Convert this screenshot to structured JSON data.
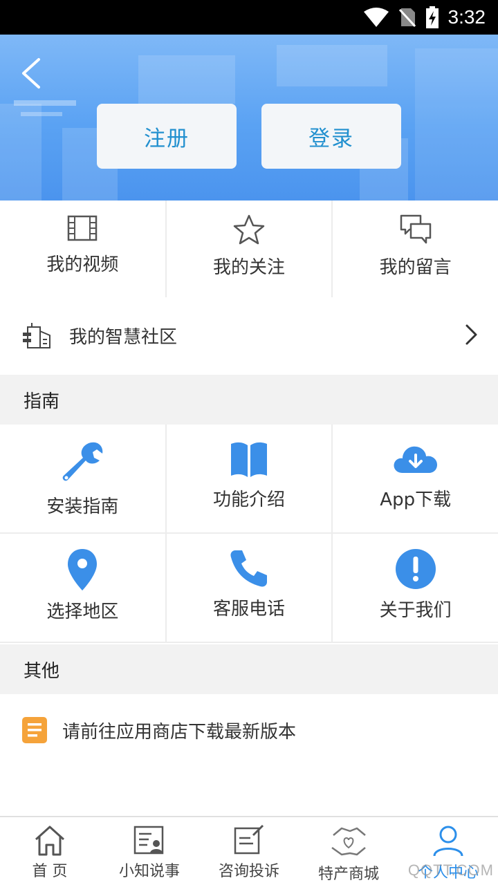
{
  "status_bar": {
    "time": "3:32"
  },
  "header": {
    "register_label": "注册",
    "login_label": "登录"
  },
  "top_grid": [
    {
      "label": "我的视频",
      "icon": "film-icon"
    },
    {
      "label": "我的关注",
      "icon": "star-icon"
    },
    {
      "label": "我的留言",
      "icon": "chat-icon"
    }
  ],
  "community": {
    "label": "我的智慧社区",
    "icon": "building-icon"
  },
  "guide": {
    "title": "指南",
    "items": [
      {
        "label": "安装指南",
        "icon": "wrench-icon"
      },
      {
        "label": "功能介绍",
        "icon": "book-icon"
      },
      {
        "label": "App下载",
        "icon": "cloud-download-icon"
      },
      {
        "label": "选择地区",
        "icon": "location-pin-icon"
      },
      {
        "label": "客服电话",
        "icon": "phone-icon"
      },
      {
        "label": "关于我们",
        "icon": "info-exclamation-icon"
      }
    ]
  },
  "other": {
    "title": "其他",
    "items": [
      {
        "label": "请前往应用商店下载最新版本",
        "icon": "document-icon"
      }
    ]
  },
  "bottom_nav": [
    {
      "label": "首 页",
      "icon": "home-icon"
    },
    {
      "label": "小知说事",
      "icon": "news-icon"
    },
    {
      "label": "咨询投诉",
      "icon": "edit-icon"
    },
    {
      "label": "特产商城",
      "icon": "handshake-heart-icon"
    },
    {
      "label": "个人中心",
      "icon": "person-icon",
      "active": true
    }
  ],
  "watermark": "QQTT.COM",
  "colors": {
    "accent": "#2c8fea",
    "icon_blue": "#3b8fe8",
    "header_blue": "#5aa2f3",
    "orange": "#f5a33a"
  }
}
